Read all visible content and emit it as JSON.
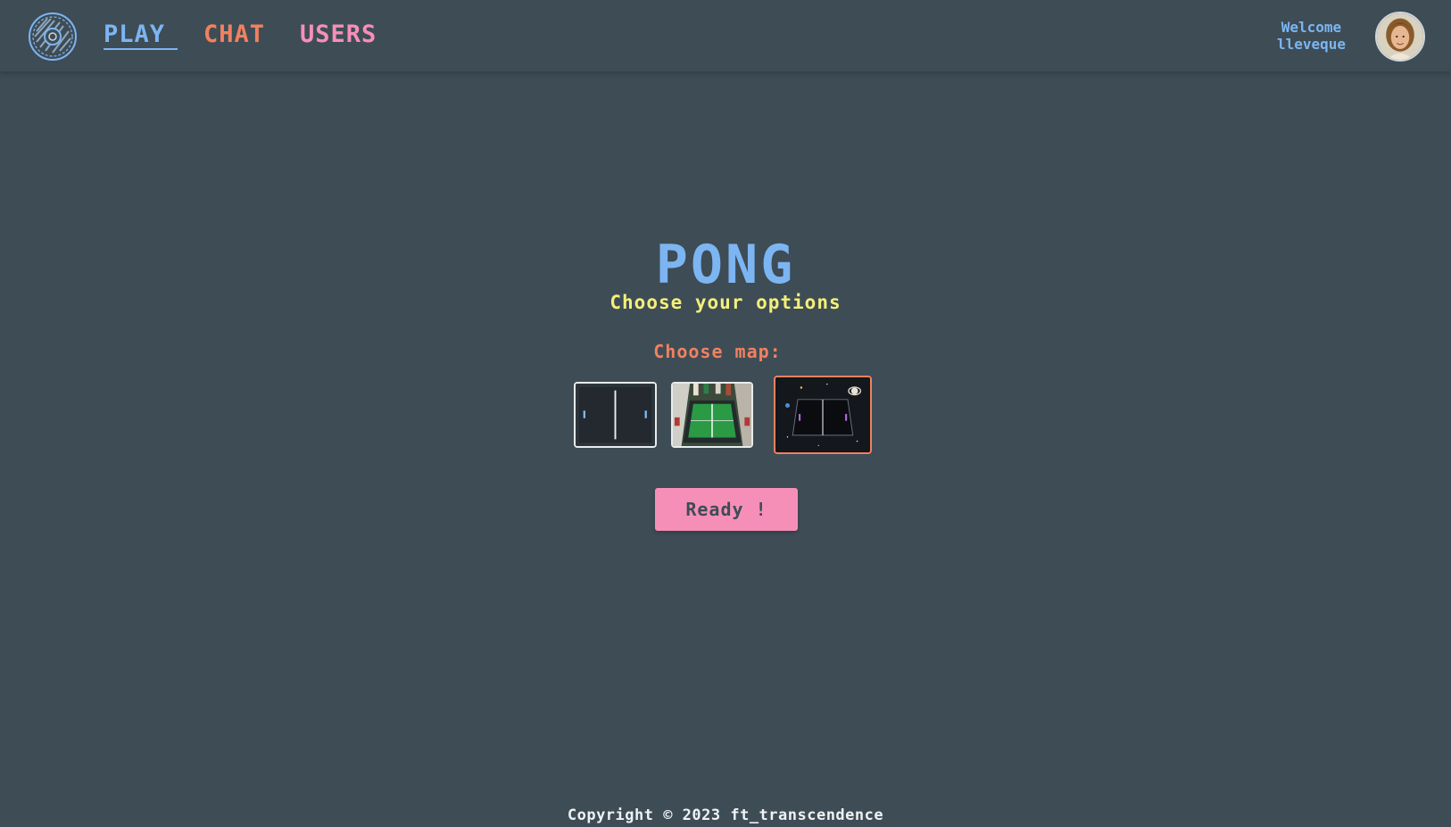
{
  "nav": {
    "logo_icon": "pong-logo-icon",
    "links": [
      {
        "label": "PLAY",
        "color": "#7cb5f2",
        "active": true
      },
      {
        "label": "CHAT",
        "color": "#f1815f",
        "active": false
      },
      {
        "label": "USERS",
        "color": "#f68fb8",
        "active": false
      }
    ],
    "welcome_label": "Welcome",
    "username": "lleveque",
    "avatar_icon": "user-avatar"
  },
  "main": {
    "title": "PONG",
    "subtitle": "Choose your options",
    "map_label": "Choose map:",
    "maps": [
      {
        "name": "classic",
        "selected": false
      },
      {
        "name": "table-tennis",
        "selected": false
      },
      {
        "name": "space",
        "selected": true
      }
    ],
    "ready_label": "Ready !"
  },
  "footer": {
    "copyright": "Copyright © 2023 ft_transcendence"
  },
  "colors": {
    "background": "#3e4c55",
    "blue": "#7cb5f2",
    "orange": "#f1815f",
    "pink": "#f68fb8",
    "yellow": "#f3ef7a"
  }
}
